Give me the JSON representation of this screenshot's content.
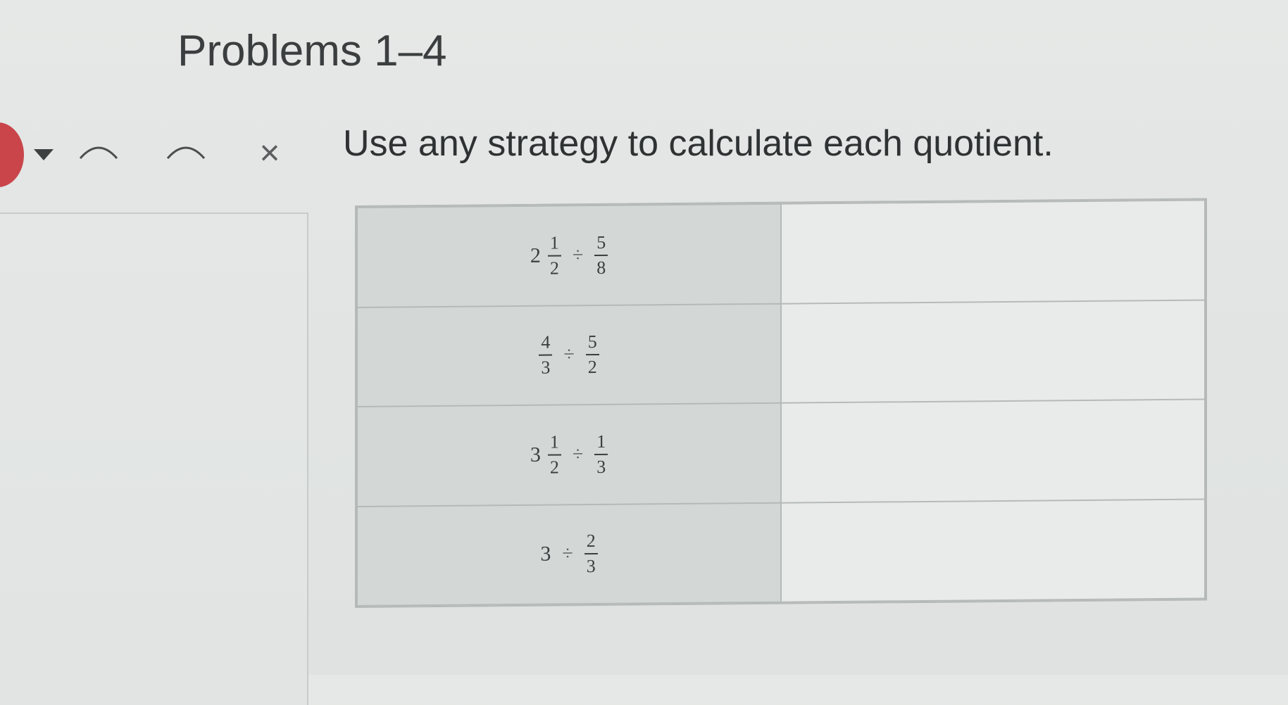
{
  "header": {
    "title": "Problems 1–4"
  },
  "toolbar": {
    "tools": [
      {
        "name": "caret-down-icon"
      },
      {
        "name": "arc-tool-icon"
      },
      {
        "name": "arc-tool-icon"
      },
      {
        "name": "close-icon",
        "glyph": "×"
      }
    ]
  },
  "instruction": "Use any strategy to calculate each quotient.",
  "problems": [
    {
      "whole": "2",
      "num1": "1",
      "den1": "2",
      "op": "÷",
      "num2": "5",
      "den2": "8"
    },
    {
      "whole": "",
      "num1": "4",
      "den1": "3",
      "op": "÷",
      "num2": "5",
      "den2": "2"
    },
    {
      "whole": "3",
      "num1": "1",
      "den1": "2",
      "op": "÷",
      "num2": "1",
      "den2": "3"
    },
    {
      "whole": "3",
      "num1": "",
      "den1": "",
      "op": "÷",
      "num2": "2",
      "den2": "3"
    }
  ],
  "colors": {
    "accent_red": "#c9454a",
    "expr_cell_bg": "#d3d8d7",
    "answer_cell_bg": "#e8ebea"
  }
}
